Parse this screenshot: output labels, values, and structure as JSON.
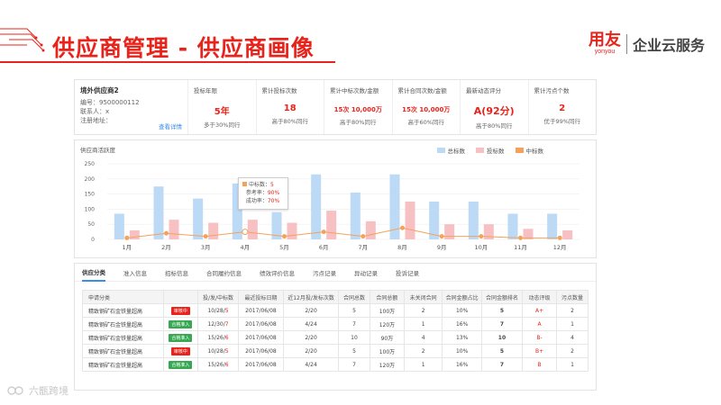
{
  "header": {
    "title": "供应商管理 - 供应商画像",
    "logo_cn": "用友",
    "logo_en": "yonyou",
    "logo_sub": "企业云服务"
  },
  "supplier": {
    "name": "境外供应商2",
    "code_label": "编号：9500000112",
    "contact_label": "联系人：x",
    "address_label": "注册地址：",
    "detail_link": "查看详情"
  },
  "stats": [
    {
      "label": "投标年限",
      "value": "5年",
      "sub": "多于30%同行",
      "size": "normal"
    },
    {
      "label": "累计投标次数",
      "value": "18",
      "sub": "高于80%同行",
      "size": "normal"
    },
    {
      "label": "累计中标次数/金额",
      "value": "15次  10,000万",
      "sub": "高于80%同行",
      "size": "small"
    },
    {
      "label": "累计合同次数/金额",
      "value": "15次  10,000万",
      "sub": "高于60%同行",
      "size": "small"
    },
    {
      "label": "最新动态评分",
      "value": "A(92分)",
      "sub": "高于80%同行",
      "size": "big"
    },
    {
      "label": "累计污点个数",
      "value": "2",
      "sub": "优于99%同行",
      "size": "normal"
    }
  ],
  "chart_panel_title": "供应商活跃度",
  "chart_data": {
    "type": "bar",
    "categories": [
      "1月",
      "2月",
      "3月",
      "4月",
      "5月",
      "6月",
      "7月",
      "8月",
      "9月",
      "10月",
      "11月",
      "12月"
    ],
    "series": [
      {
        "name": "总标数",
        "type": "bar",
        "values": [
          85,
          175,
          135,
          185,
          90,
          215,
          155,
          215,
          125,
          125,
          85,
          85
        ]
      },
      {
        "name": "投标数",
        "type": "bar",
        "values": [
          30,
          65,
          55,
          65,
          55,
          95,
          60,
          125,
          50,
          50,
          35,
          30
        ]
      },
      {
        "name": "中标数",
        "type": "line",
        "values": [
          5,
          20,
          10,
          25,
          10,
          25,
          10,
          38,
          10,
          10,
          5,
          5
        ]
      }
    ],
    "yticks": [
      0,
      50,
      100,
      150,
      200,
      250
    ],
    "ylim": [
      0,
      250
    ],
    "colors": {
      "总标数": "#bcd9f5",
      "投标数": "#f7c0c3",
      "中标数": "#f4a259"
    },
    "legend_position": "top-right",
    "tooltip": {
      "category": "4月",
      "line1_label": "中标数：",
      "line1_value": "5",
      "line2_label": "参考率：",
      "line2_value": "90%",
      "line3_label": "成功率：",
      "line3_value": "70%"
    }
  },
  "tabs": [
    "供应分类",
    "准入信息",
    "招标信息",
    "合同履约信息",
    "绩效评价信息",
    "污点记录",
    "异动记录",
    "投诉记录"
  ],
  "table": {
    "headers": [
      "申请分类",
      "",
      "投/发/中标数",
      "最近投标日期",
      "近12月投/发标次数",
      "合同总数",
      "合同总额",
      "未关闭合同",
      "合同金额占比",
      "合同金额排名",
      "动态评级",
      "污点数量"
    ],
    "rows": [
      {
        "name": "精致钢矿石金铁量超高",
        "badge": "审核中",
        "badge_color": "#e8231b",
        "bids_a": "10/28/",
        "bids_b": "5",
        "date": "2017/06/08",
        "recent": "2/20",
        "contracts": "5",
        "amount": "100万",
        "open": "2",
        "ratio": "10%",
        "rank": "5",
        "grade": "A+",
        "stains": "2"
      },
      {
        "name": "精致钢矿石金铁量超高",
        "badge": "合格准入",
        "badge_color": "#36a852",
        "bids_a": "12/30/",
        "bids_b": "7",
        "date": "2017/06/08",
        "recent": "4/24",
        "contracts": "7",
        "amount": "120万",
        "open": "1",
        "ratio": "16%",
        "rank": "7",
        "grade": "A",
        "stains": "1"
      },
      {
        "name": "精致钢矿石金铁量超高",
        "badge": "合格准入",
        "badge_color": "#36a852",
        "bids_a": "15/26/",
        "bids_b": "6",
        "date": "2017/06/08",
        "recent": "2/20",
        "contracts": "10",
        "amount": "90万",
        "open": "4",
        "ratio": "13%",
        "rank": "10",
        "grade": "B-",
        "stains": "4"
      },
      {
        "name": "精致钢矿石金铁量超高",
        "badge": "审核中",
        "badge_color": "#e8231b",
        "bids_a": "10/28/",
        "bids_b": "5",
        "date": "2017/06/08",
        "recent": "2/20",
        "contracts": "5",
        "amount": "100万",
        "open": "2",
        "ratio": "10%",
        "rank": "5",
        "grade": "B+",
        "stains": "2"
      },
      {
        "name": "精致钢矿石金铁量超高",
        "badge": "合格准入",
        "badge_color": "#36a852",
        "bids_a": "15/26/",
        "bids_b": "6",
        "date": "2017/06/08",
        "recent": "4/24",
        "contracts": "7",
        "amount": "120万",
        "open": "1",
        "ratio": "16%",
        "rank": "7",
        "grade": "B",
        "stains": "1"
      }
    ]
  },
  "watermark": "六甑跨境"
}
